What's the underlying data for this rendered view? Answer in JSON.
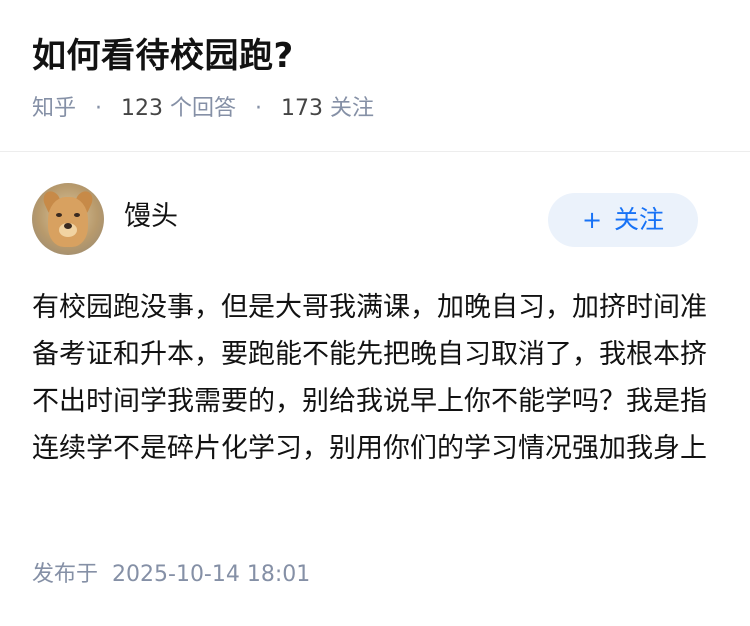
{
  "question": {
    "title": "如何看待校园跑?",
    "source": "知乎",
    "separator": "·",
    "answer_count": "123",
    "answer_label": "个回答",
    "follower_count": "173",
    "follower_label": "关注"
  },
  "answer": {
    "author_name": "馒头",
    "follow_button_label": "关注",
    "follow_button_plus": "+",
    "content": "有校园跑没事，但是大哥我满课，加晚自习，加挤时间准备考证和升本，要跑能不能先把晚自习取消了，我根本挤不出时间学我需要的，别给我说早上你不能学吗？我是指连续学不是碎片化学习，别用你们的学习情况强加我身上",
    "publish_label": "发布于",
    "publish_time": "2025-10-14 18:01"
  },
  "colors": {
    "accent": "#1772f6",
    "follow_bg": "#ebf2fb",
    "meta_text": "#8590a6",
    "divider": "#ededed"
  },
  "icons": {
    "avatar": "dog-avatar-icon"
  }
}
